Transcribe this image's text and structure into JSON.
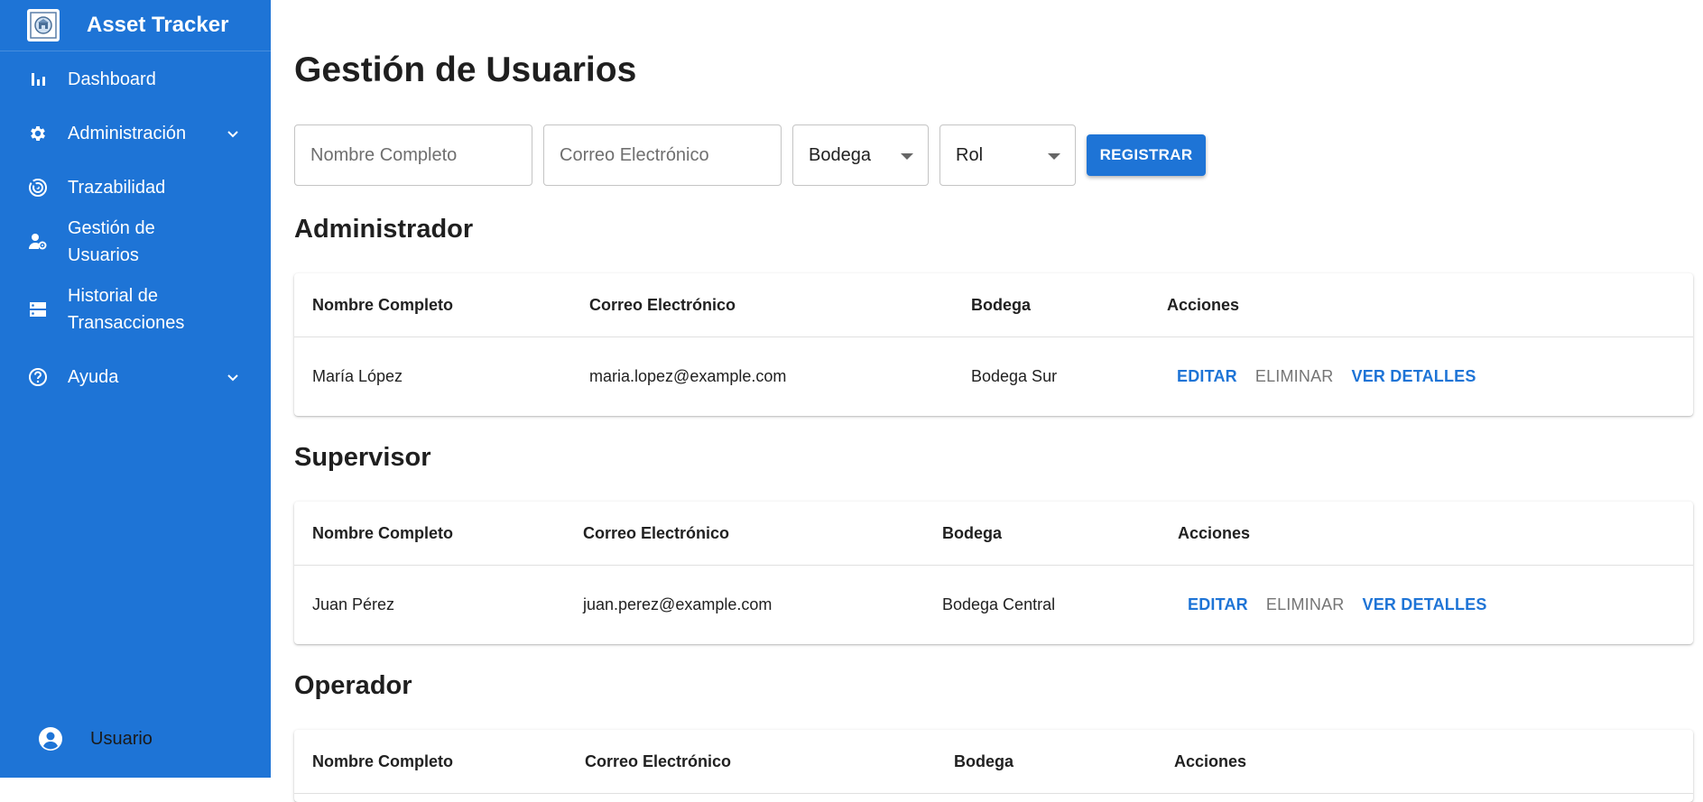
{
  "app": {
    "title": "Asset Tracker",
    "logo_icon": "warehouse-logo",
    "accent_color": "#1e74d6"
  },
  "sidebar": {
    "items": [
      {
        "label": "Dashboard",
        "icon": "bar-chart-icon"
      },
      {
        "label": "Administración",
        "icon": "gear-icon",
        "expandable": true
      },
      {
        "label": "Trazabilidad",
        "icon": "radar-icon"
      },
      {
        "label": "Gestión de Usuarios",
        "icon": "user-settings-icon"
      },
      {
        "label": "Historial de Transacciones",
        "icon": "storage-icon"
      },
      {
        "label": "Ayuda",
        "icon": "help-circle-icon",
        "expandable": true
      }
    ],
    "user_label": "Usuario"
  },
  "page": {
    "title": "Gestión de Usuarios"
  },
  "form": {
    "name_placeholder": "Nombre Completo",
    "email_placeholder": "Correo Electrónico",
    "bodega_label": "Bodega",
    "rol_label": "Rol",
    "submit_label": "REGISTRAR"
  },
  "groups": [
    {
      "role": "Administrador",
      "headers": [
        "Nombre Completo",
        "Correo Electrónico",
        "Bodega",
        "Acciones"
      ],
      "rows": [
        {
          "name": "María López",
          "email": "maria.lopez@example.com",
          "bodega": "Bodega Sur"
        }
      ]
    },
    {
      "role": "Supervisor",
      "headers": [
        "Nombre Completo",
        "Correo Electrónico",
        "Bodega",
        "Acciones"
      ],
      "rows": [
        {
          "name": "Juan Pérez",
          "email": "juan.perez@example.com",
          "bodega": "Bodega Central"
        }
      ]
    },
    {
      "role": "Operador",
      "headers": [
        "Nombre Completo",
        "Correo Electrónico",
        "Bodega",
        "Acciones"
      ],
      "rows": []
    }
  ],
  "actions": {
    "edit": "EDITAR",
    "delete": "ELIMINAR",
    "details": "VER DETALLES"
  }
}
